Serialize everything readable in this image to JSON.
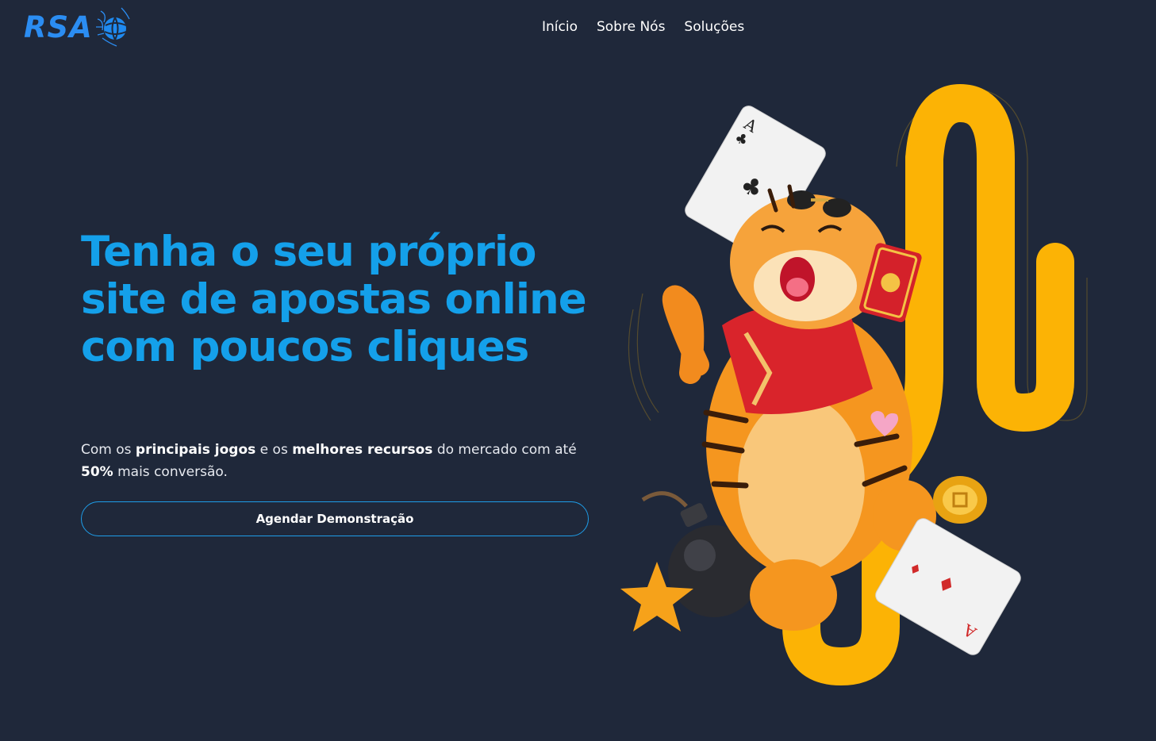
{
  "brand": {
    "logo_text": "RSA",
    "accent": "#2b8df2"
  },
  "nav": {
    "items": [
      "Início",
      "Sobre Nós",
      "Soluções"
    ]
  },
  "hero": {
    "title": "Tenha o seu próprio site de apostas online com poucos cliques",
    "subtitle": {
      "part1": "Com os ",
      "bold1": "principais jogos",
      "part2": " e os ",
      "bold2": "melhores recursos",
      "part3": " do mercado com até ",
      "bold3": "50%",
      "part4": " mais conversão."
    },
    "cta_label": "Agendar Demonstração",
    "title_color": "#14a0ea"
  },
  "illustration": {
    "card_top_rank": "A",
    "card_bottom_rank": "A",
    "icons": [
      "globe-icon",
      "tiger-illustration",
      "playing-card-club",
      "playing-card-diamond",
      "bomb-icon",
      "star-icon",
      "coin-icon",
      "red-envelope-icon",
      "heart-icon"
    ],
    "ribbon_color": "#fcb305"
  },
  "colors": {
    "background": "#1f283a",
    "cta_border": "#1e9de8"
  }
}
